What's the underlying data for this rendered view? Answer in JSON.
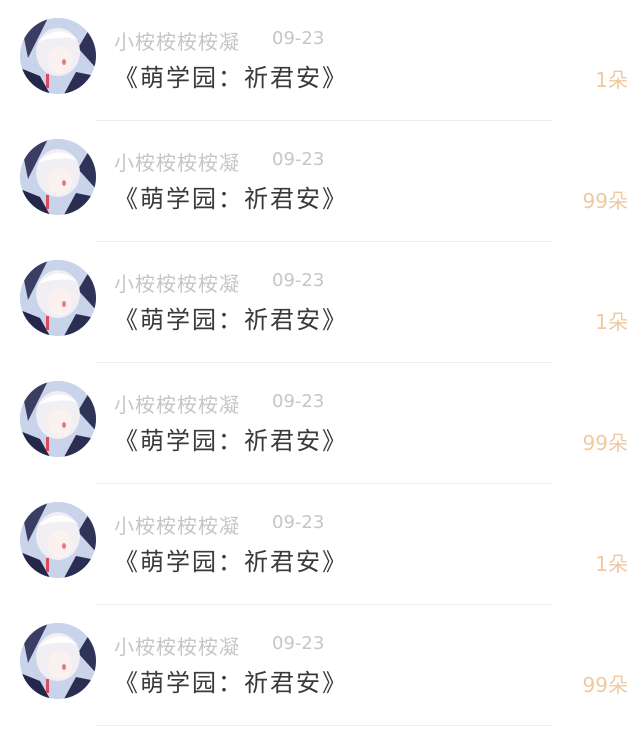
{
  "rows": [
    {
      "username": "小桉桉桉桉凝",
      "date": "09-23",
      "title": "《萌学园：祈君安》",
      "count": "1朵"
    },
    {
      "username": "小桉桉桉桉凝",
      "date": "09-23",
      "title": "《萌学园：祈君安》",
      "count": "99朵"
    },
    {
      "username": "小桉桉桉桉凝",
      "date": "09-23",
      "title": "《萌学园：祈君安》",
      "count": "1朵"
    },
    {
      "username": "小桉桉桉桉凝",
      "date": "09-23",
      "title": "《萌学园：祈君安》",
      "count": "99朵"
    },
    {
      "username": "小桉桉桉桉凝",
      "date": "09-23",
      "title": "《萌学园：祈君安》",
      "count": "1朵"
    },
    {
      "username": "小桉桉桉桉凝",
      "date": "09-23",
      "title": "《萌学园：祈君安》",
      "count": "99朵"
    }
  ],
  "colors": {
    "username": "#c6c6c6",
    "title": "#3a3a3a",
    "count": "#efc9a0",
    "divider": "#ededed"
  },
  "icons": {
    "avatar": "anime-avatar-icon"
  }
}
